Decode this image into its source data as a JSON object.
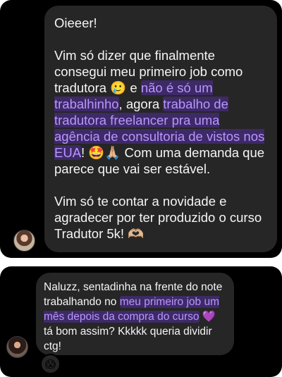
{
  "message1": {
    "greeting": "Oieeer!",
    "p2_part1": "Vim só dizer que finalmente consegui meu primeiro job como tradutora ",
    "p2_emoji1": "🥲",
    "p2_part2": " e ",
    "p2_hl1": "não é só um trabalhinho",
    "p2_part3": ", agora ",
    "p2_hl2": "trabalho de tradutora freelancer pra uma agência de consultoria de vistos nos EUA",
    "p2_part4": "! ",
    "p2_emoji2": "🤩🙏🏼",
    "p2_part5": " Com uma demanda que parece que vai ser estável.",
    "p3_text": "Vim só te contar a novidade e agradecer por ter produzido o curso Tradutor 5k! ",
    "p3_emoji": "🫶🏼"
  },
  "message2": {
    "part1": "Naluzz, sentadinha na frente do note trabalhando no ",
    "hl1": "meu primeiro job um mês depois da compra do curso",
    "part2": " ",
    "emoji": "💜",
    "part3": " tá bom assim? Kkkkk queria dividir ctg!",
    "reaction": "😱"
  }
}
